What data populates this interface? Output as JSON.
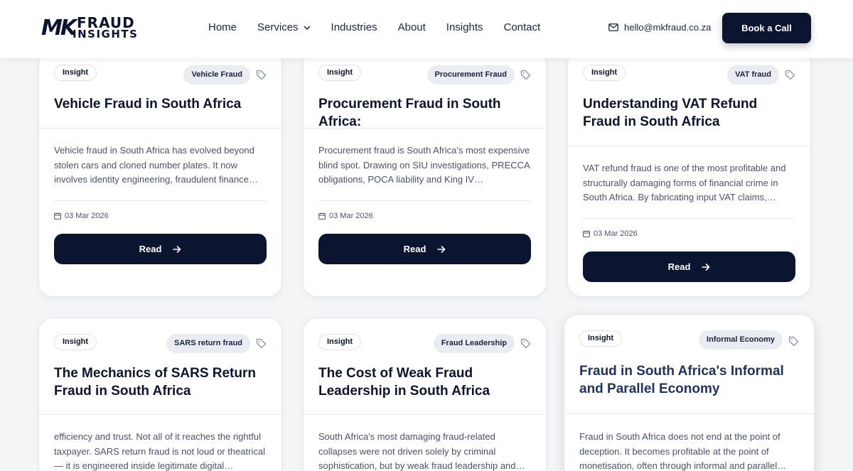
{
  "header": {
    "logo_mk": "MK",
    "logo_word1": "FRAUD",
    "logo_word2": "INSIGHTS",
    "nav": [
      "Home",
      "Services",
      "Industries",
      "About",
      "Insights",
      "Contact"
    ],
    "email": "hello@mkfraud.co.za",
    "cta": "Book a Call"
  },
  "cards": [
    {
      "badge": "Insight",
      "category": "Vehicle Fraud",
      "title": "Vehicle Fraud in South Africa",
      "excerpt": "Vehicle fraud in South Africa has evolved beyond stolen cars and cloned number plates. It now involves identity engineering, fraudulent finance…",
      "date": "03 Mar 2026",
      "read": "Read"
    },
    {
      "badge": "Insight",
      "category": "Procurement Fraud",
      "title": "Procurement Fraud in South Africa:",
      "excerpt": "Procurement fraud is South Africa's most expensive blind spot. Drawing on SIU investigations, PRECCA obligations, POCA liability and King IV governance…",
      "date": "03 Mar 2026",
      "read": "Read"
    },
    {
      "badge": "Insight",
      "category": "VAT fraud",
      "title": "Understanding VAT Refund Fraud in South Africa",
      "excerpt": "VAT refund fraud is one of the most profitable and structurally damaging forms of financial crime in South Africa. By fabricating input VAT claims,…",
      "date": "03 Mar 2026",
      "read": "Read"
    },
    {
      "badge": "Insight",
      "category": "SARS return fraud",
      "title": "The Mechanics of SARS Return Fraud in South Africa",
      "excerpt": "efficiency and trust. Not all of it reaches the rightful taxpayer. SARS return fraud is not loud or theatrical — it is engineered inside legitimate digital…"
    },
    {
      "badge": "Insight",
      "category": "Fraud Leadership",
      "title": "The Cost of Weak Fraud Leadership in South Africa",
      "excerpt": "South Africa's most damaging fraud-related collapses were not driven solely by criminal sophistication, but by weak fraud leadership and…"
    },
    {
      "badge": "Insight",
      "category": "Informal Economy",
      "title": "Fraud in South Africa's Informal and Parallel Economy",
      "excerpt": "Fraud in South Africa does not end at the point of deception. It becomes profitable at the point of monetisation, often through informal and parallel…"
    }
  ],
  "colors": {
    "navy": "#0b1530",
    "background": "#f4f5f7",
    "tag_bg": "#e9ecf1"
  },
  "icons": [
    "mail-icon",
    "chevron-down-icon",
    "tag-icon",
    "calendar-icon",
    "arrow-right-icon"
  ]
}
